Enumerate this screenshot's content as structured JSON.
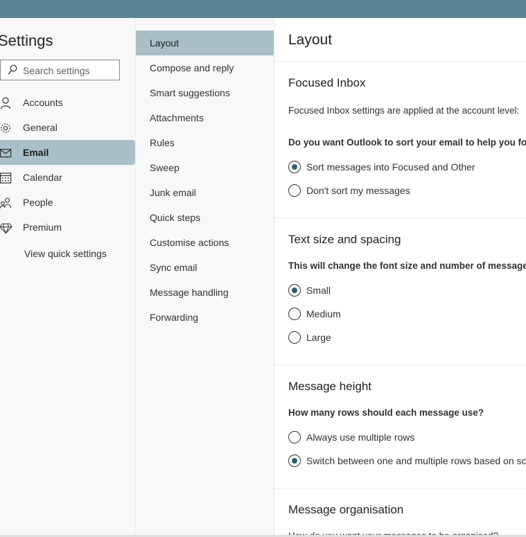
{
  "settings_panel": {
    "title": "Settings",
    "search_placeholder": "Search settings",
    "nav": [
      {
        "label": "Accounts",
        "icon": "person-icon"
      },
      {
        "label": "General",
        "icon": "gear-icon"
      },
      {
        "label": "Email",
        "icon": "mail-icon",
        "active": true
      },
      {
        "label": "Calendar",
        "icon": "calendar-icon"
      },
      {
        "label": "People",
        "icon": "people-icon"
      },
      {
        "label": "Premium",
        "icon": "diamond-icon"
      }
    ],
    "quick_settings_label": "View quick settings"
  },
  "email_menu": {
    "items": [
      "Layout",
      "Compose and reply",
      "Smart suggestions",
      "Attachments",
      "Rules",
      "Sweep",
      "Junk email",
      "Quick steps",
      "Customise actions",
      "Sync email",
      "Message handling",
      "Forwarding"
    ],
    "active": "Layout"
  },
  "content": {
    "title": "Layout",
    "focused_inbox": {
      "heading": "Focused Inbox",
      "note": "Focused Inbox settings are applied at the account level:",
      "question": "Do you want Outlook to sort your email to help you fo",
      "options": [
        "Sort messages into Focused and Other",
        "Don't sort my messages"
      ],
      "selected": 0
    },
    "text_size": {
      "heading": "Text size and spacing",
      "question": "This will change the font size and number of messages",
      "options": [
        "Small",
        "Medium",
        "Large"
      ],
      "selected": 0
    },
    "message_height": {
      "heading": "Message height",
      "question": "How many rows should each message use?",
      "options": [
        "Always use multiple rows",
        "Switch between one and multiple rows based on scr"
      ],
      "selected": 1
    },
    "message_organisation": {
      "heading": "Message organisation",
      "question": "How do you want your messages to be organised?"
    }
  },
  "colors": {
    "top_bar": "#5b8596",
    "active_item": "#a9c0c8",
    "radio_selected": "#2b5f75"
  }
}
